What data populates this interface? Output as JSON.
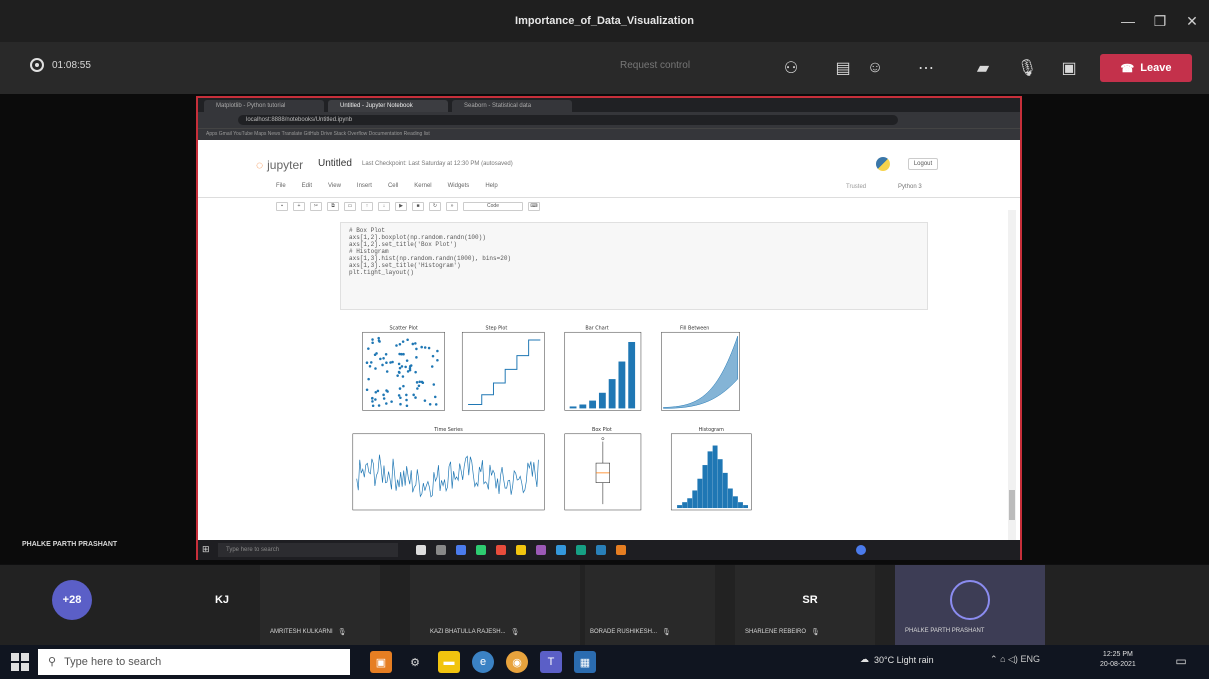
{
  "window": {
    "title": "Importance_of_Data_Visualization"
  },
  "meeting": {
    "timer": "01:08:55",
    "request_control": "Request control",
    "leave_label": "Leave",
    "toolbar_icons": [
      "participants-icon",
      "chat-icon",
      "reactions-icon",
      "more-icon",
      "camera-off-icon",
      "mic-off-icon",
      "share-icon"
    ]
  },
  "browser": {
    "tabs": [
      "Matplotlib - Python tutorial",
      "Untitled - Jupyter Notebook",
      "Seaborn - Statistical data"
    ],
    "address": "localhost:8888/notebooks/Untitled.ipynb",
    "bookmarks": "Apps   Gmail   YouTube   Maps   News   Translate   GitHub   Drive   Stack Overflow   Documentation   Reading list"
  },
  "jupyter": {
    "logo_text": "jupyter",
    "notebook_name": "Untitled",
    "last_checkpoint": "Last Checkpoint: Last Saturday at 12:30 PM (autosaved)",
    "logout": "Logout",
    "menu": [
      "File",
      "Edit",
      "View",
      "Insert",
      "Cell",
      "Kernel",
      "Widgets",
      "Help"
    ],
    "trusted": "Trusted",
    "kernel": "Python 3",
    "cell_type": "Code",
    "code_lines": [
      "# Box Plot",
      "axs[1,2].boxplot(np.random.randn(100))",
      "axs[1,2].set_title('Box Plot')",
      "",
      "# Histogram",
      "axs[1,3].hist(np.random.randn(1000), bins=20)",
      "axs[1,3].set_title('Histogram')",
      "",
      "plt.tight_layout()"
    ]
  },
  "chart_data": [
    {
      "type": "scatter",
      "title": "Scatter Plot"
    },
    {
      "type": "line",
      "title": "Step Plot"
    },
    {
      "type": "bar",
      "title": "Bar Chart"
    },
    {
      "type": "area",
      "title": "Fill Between"
    },
    {
      "type": "line",
      "title": "Time Series"
    },
    {
      "type": "box",
      "title": "Box Plot"
    },
    {
      "type": "bar",
      "title": "Histogram"
    }
  ],
  "inner_taskbar": {
    "search": "Type here to search"
  },
  "presenter_name": "PHALKE PARTH PRASHANT",
  "gallery": {
    "overflow_count": "+28",
    "participants": [
      {
        "initials": "",
        "name": "",
        "color": "#6b5b4a"
      },
      {
        "initials": "KJ",
        "name": "",
        "color": "#d0d0d0"
      },
      {
        "initials": "",
        "name": "AMRITESH KULKARNI",
        "color": "#4a6b5b"
      },
      {
        "initials": "",
        "name": "KAZI BHATULLA RAJESH...",
        "color": "#7a6b5e"
      },
      {
        "initials": "",
        "name": "BORADE RUSHIKESH...",
        "color": "#1a1a1a"
      },
      {
        "initials": "SR",
        "name": "SHARLENE REBEIRO",
        "color": "#5b7fb0"
      },
      {
        "initials": "",
        "name": "PHALKE PARTH PRASHANT",
        "color": "#3a4a6b"
      },
      {
        "initials": "",
        "name": "",
        "color": "#c0392b"
      }
    ]
  },
  "windows_taskbar": {
    "search_placeholder": "Type here to search",
    "weather": "30°C  Light rain",
    "language": "ENG",
    "time": "12:25 PM",
    "date": "20-08-2021"
  }
}
